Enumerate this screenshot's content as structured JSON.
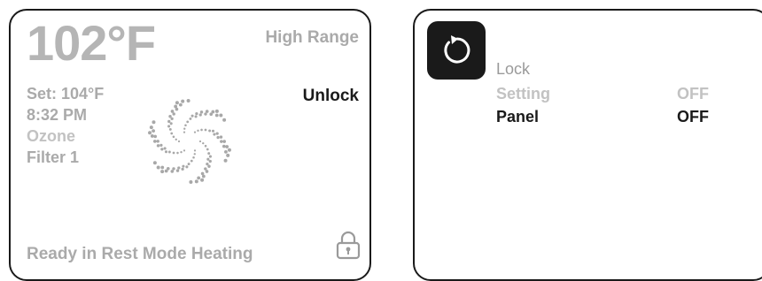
{
  "main_screen": {
    "temperature": "102°F",
    "range": "High Range",
    "lock_action": "Unlock",
    "set_point": "Set: 104°F",
    "time": "8:32 PM",
    "ozone": "Ozone",
    "filter": "Filter 1",
    "status": "Ready in Rest Mode Heating",
    "spinner_icon": "pump-spinner-icon",
    "lock_icon": "padlock-icon"
  },
  "lock_screen": {
    "back_icon": "back-arrow-icon",
    "title": "Lock",
    "rows": [
      {
        "label": "Setting",
        "value": "OFF"
      },
      {
        "label": "Panel",
        "value": "OFF"
      }
    ]
  },
  "colors": {
    "border": "#1a1a1a",
    "primary_text": "#1a1a1a",
    "dim_text": "#aaaaaa",
    "light_text": "#c2c2c2",
    "temperature_text": "#b5b5b5"
  }
}
